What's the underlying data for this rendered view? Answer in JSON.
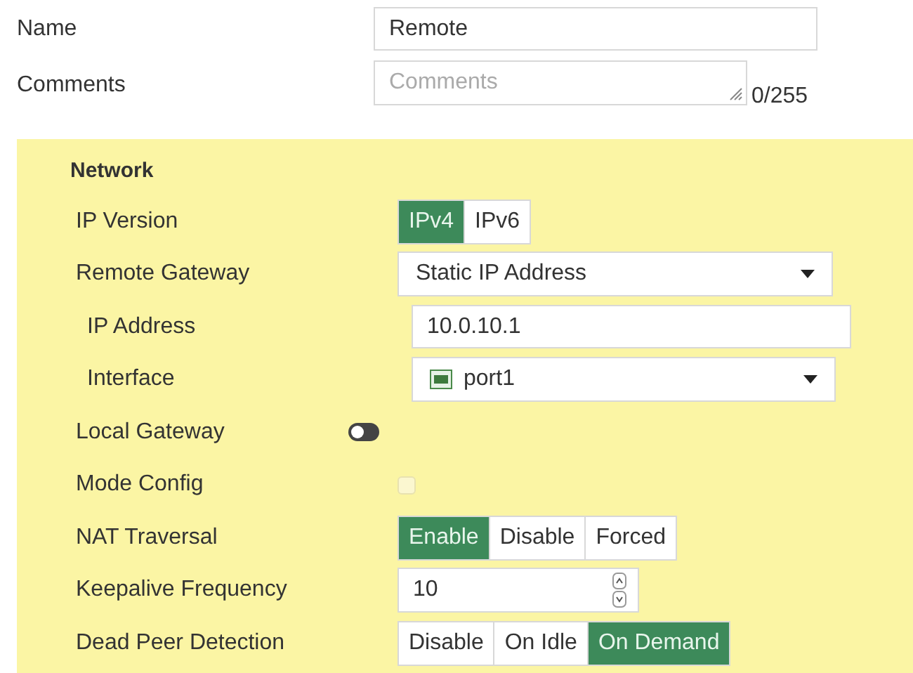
{
  "name": {
    "label": "Name",
    "value": "Remote"
  },
  "comments": {
    "label": "Comments",
    "placeholder": "Comments",
    "counter": "0/255"
  },
  "network": {
    "title": "Network",
    "fields": [
      {
        "kind": "segmented",
        "label": "IP Version",
        "options": [
          {
            "label": "IPv4",
            "selected": true
          },
          {
            "label": "IPv6",
            "selected": false
          }
        ]
      },
      {
        "kind": "select",
        "label": "Remote Gateway",
        "value": "Static IP Address",
        "children": [
          {
            "kind": "text",
            "label": "IP Address",
            "value": "10.0.10.1"
          },
          {
            "kind": "select",
            "label": "Interface",
            "value": "port1",
            "port_icon": true
          }
        ]
      },
      {
        "kind": "toggle",
        "label": "Local Gateway",
        "on": false
      },
      {
        "kind": "checkbox",
        "label": "Mode Config",
        "checked": false
      },
      {
        "kind": "segmented",
        "label": "NAT Traversal",
        "options": [
          {
            "label": "Enable",
            "selected": true
          },
          {
            "label": "Disable",
            "selected": false
          },
          {
            "label": "Forced",
            "selected": false
          }
        ]
      },
      {
        "kind": "number",
        "label": "Keepalive Frequency",
        "value": "10"
      },
      {
        "kind": "segmented",
        "label": "Dead Peer Detection",
        "options": [
          {
            "label": "Disable",
            "selected": false
          },
          {
            "label": "On Idle",
            "selected": false
          },
          {
            "label": "On Demand",
            "selected": true
          }
        ]
      }
    ]
  }
}
